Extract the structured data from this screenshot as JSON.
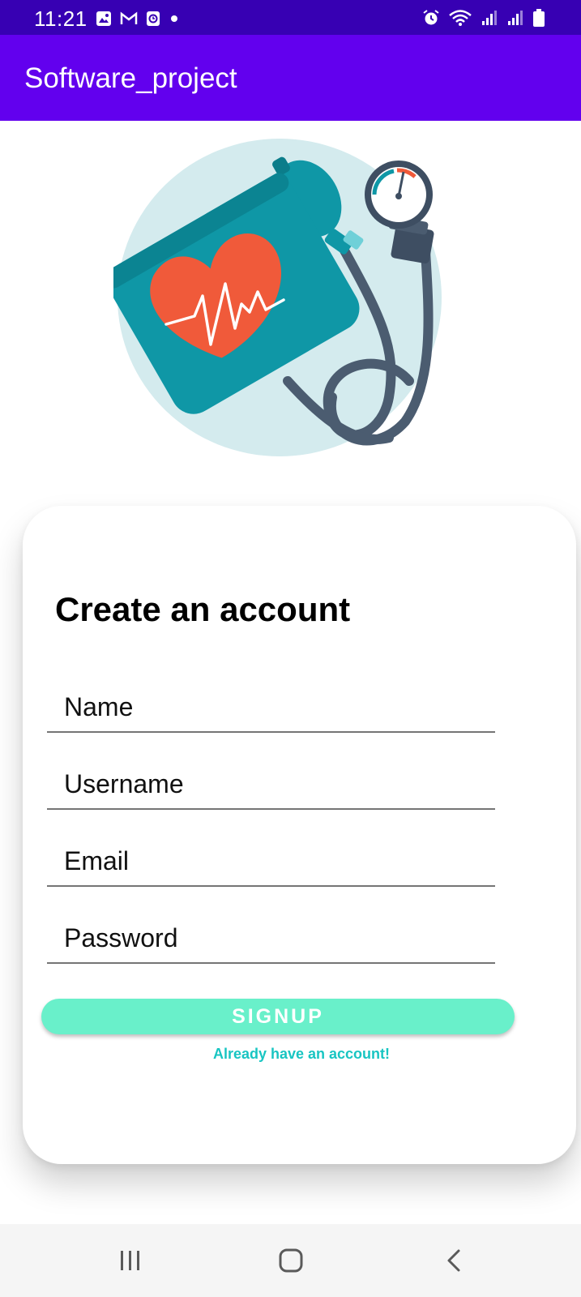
{
  "status_bar": {
    "time": "11:21",
    "left_icons": [
      "gallery-icon",
      "gmail-icon",
      "clock-app-icon",
      "dot-icon"
    ],
    "right_icons": [
      "alarm-icon",
      "wifi-icon",
      "signal-icon",
      "signal-icon",
      "battery-icon"
    ]
  },
  "app_bar": {
    "title": "Software_project"
  },
  "illustration": {
    "name": "blood-pressure-monitor"
  },
  "form": {
    "title": "Create an account",
    "fields": [
      {
        "placeholder": "Name"
      },
      {
        "placeholder": "Username"
      },
      {
        "placeholder": "Email"
      },
      {
        "placeholder": "Password"
      }
    ],
    "signup_label": "SIGNUP",
    "login_link": "Already have an account!"
  },
  "colors": {
    "status_bar": "#3700b3",
    "app_bar": "#6200ee",
    "signup_button": "#69f0ca",
    "link": "#18c5c2"
  },
  "nav_bar": {
    "buttons": [
      "recents-icon",
      "home-icon",
      "back-icon"
    ]
  }
}
